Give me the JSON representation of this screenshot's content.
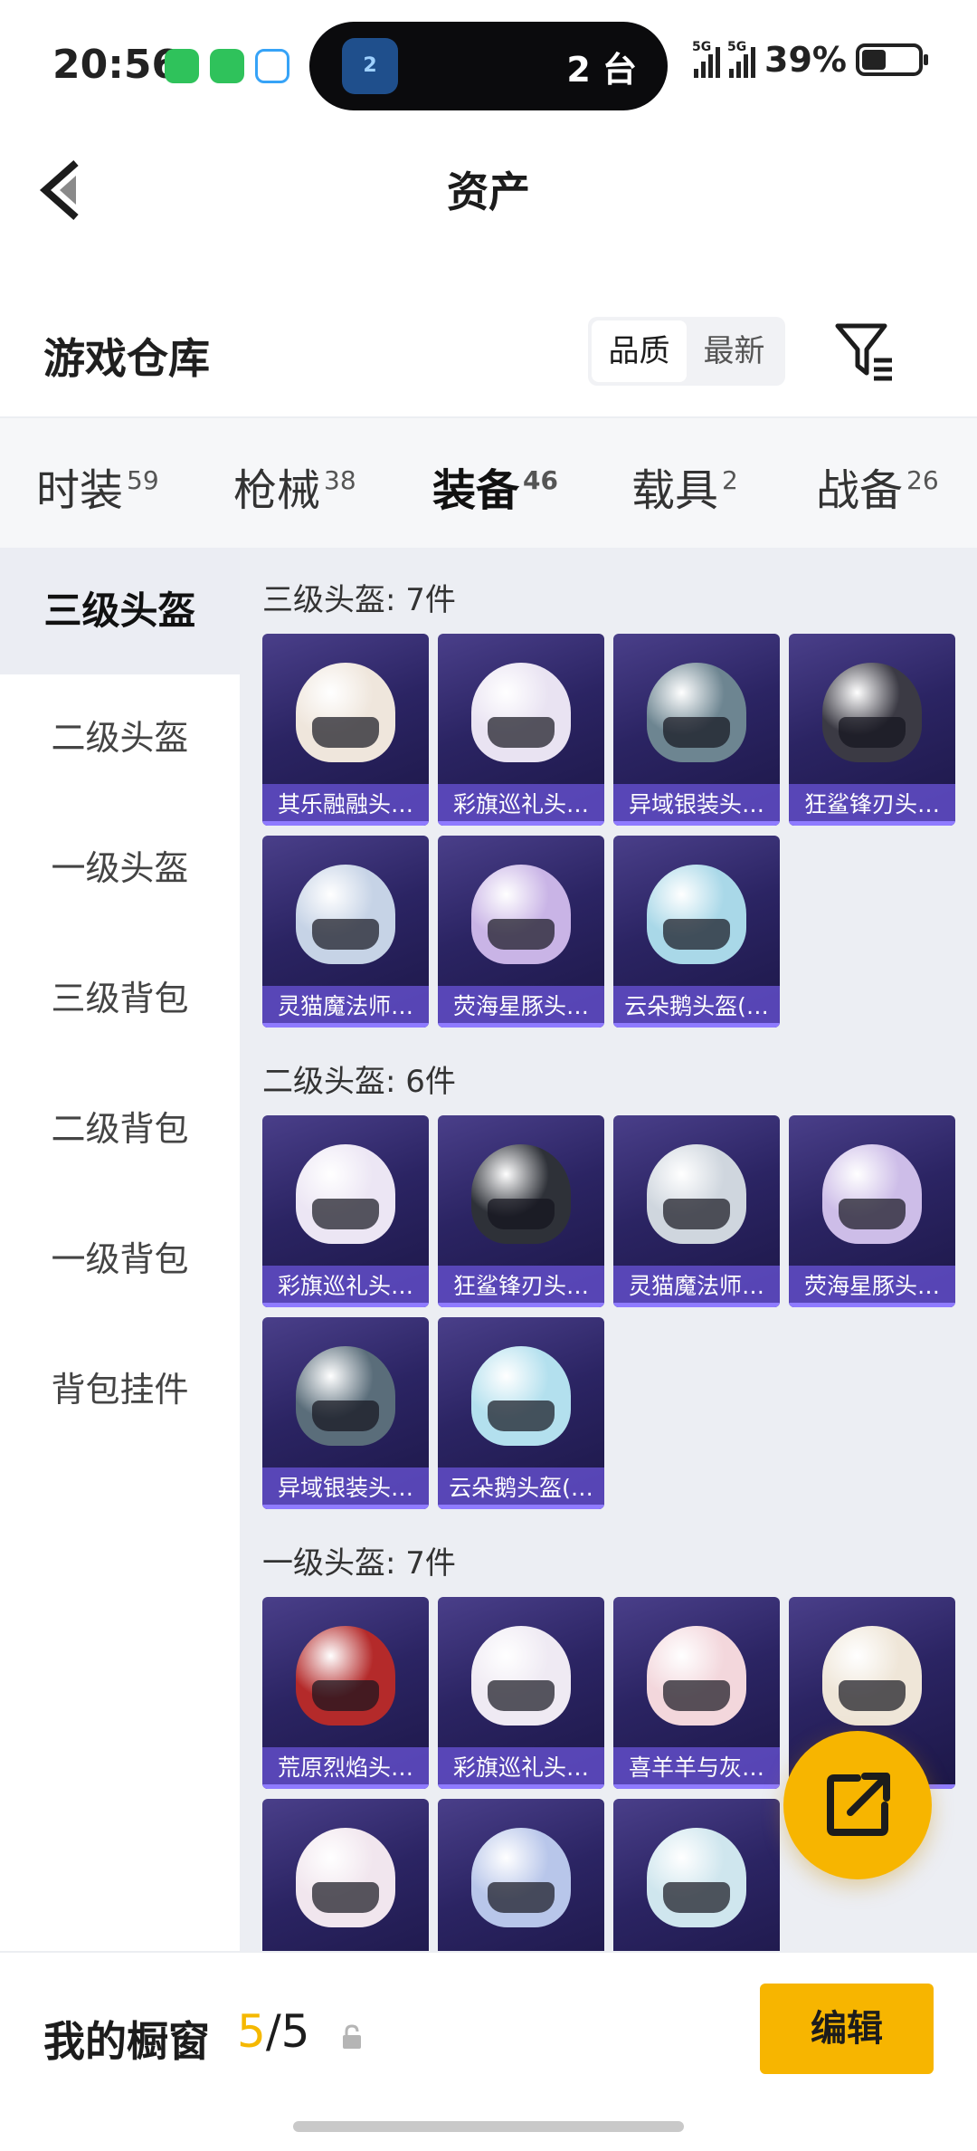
{
  "status_bar": {
    "time": "20:56",
    "island_count": "2 台",
    "island_badge": "2",
    "signal_1": "5G",
    "signal_2": "5G",
    "battery": "39%"
  },
  "header": {
    "title": "资产"
  },
  "warehouse": {
    "title": "游戏仓库",
    "sort_options": [
      "品质",
      "最新"
    ],
    "active_sort": "品质"
  },
  "tabs": [
    {
      "label": "时装",
      "count": "59"
    },
    {
      "label": "枪械",
      "count": "38"
    },
    {
      "label": "装备",
      "count": "46",
      "active": true
    },
    {
      "label": "载具",
      "count": "2"
    },
    {
      "label": "战备",
      "count": "26"
    }
  ],
  "side_nav": [
    {
      "label": "三级头盔",
      "active": true
    },
    {
      "label": "二级头盔"
    },
    {
      "label": "一级头盔"
    },
    {
      "label": "三级背包"
    },
    {
      "label": "二级背包"
    },
    {
      "label": "一级背包"
    },
    {
      "label": "背包挂件"
    }
  ],
  "sections": [
    {
      "title": "三级头盔: 7件",
      "items": [
        {
          "name": "其乐融融头…",
          "color": "#efe6dc"
        },
        {
          "name": "彩旗巡礼头…",
          "color": "#e9e3f2"
        },
        {
          "name": "异域银装头…",
          "color": "#6d8591"
        },
        {
          "name": "狂鲨锋刃头…",
          "color": "#3b3a44"
        },
        {
          "name": "灵猫魔法师…",
          "color": "#c6d3e6"
        },
        {
          "name": "荧海星豚头…",
          "color": "#c9b4e6"
        },
        {
          "name": "云朵鹅头盔(…",
          "color": "#a9d8e8"
        }
      ]
    },
    {
      "title": "二级头盔: 6件",
      "items": [
        {
          "name": "彩旗巡礼头…",
          "color": "#ece6f4"
        },
        {
          "name": "狂鲨锋刃头…",
          "color": "#2e3138"
        },
        {
          "name": "灵猫魔法师…",
          "color": "#cfd6de"
        },
        {
          "name": "荧海星豚头…",
          "color": "#cdbde8"
        },
        {
          "name": "异域银装头…",
          "color": "#5a6d7a"
        },
        {
          "name": "云朵鹅头盔(…",
          "color": "#b3e0ee"
        }
      ]
    },
    {
      "title": "一级头盔: 7件",
      "items": [
        {
          "name": "荒原烈焰头…",
          "color": "#b42a2a"
        },
        {
          "name": "彩旗巡礼头…",
          "color": "#efeaf3"
        },
        {
          "name": "喜羊羊与灰…",
          "color": "#f3d7dc"
        },
        {
          "name": "",
          "color": "#efe6d8"
        },
        {
          "name": "",
          "color": "#f1e6ee"
        },
        {
          "name": "",
          "color": "#b8c6ea"
        },
        {
          "name": "",
          "color": "#cfe6ee"
        }
      ]
    }
  ],
  "bottom": {
    "label": "我的橱窗",
    "count_current": "5",
    "count_sep": "/5",
    "edit_label": "编辑"
  }
}
